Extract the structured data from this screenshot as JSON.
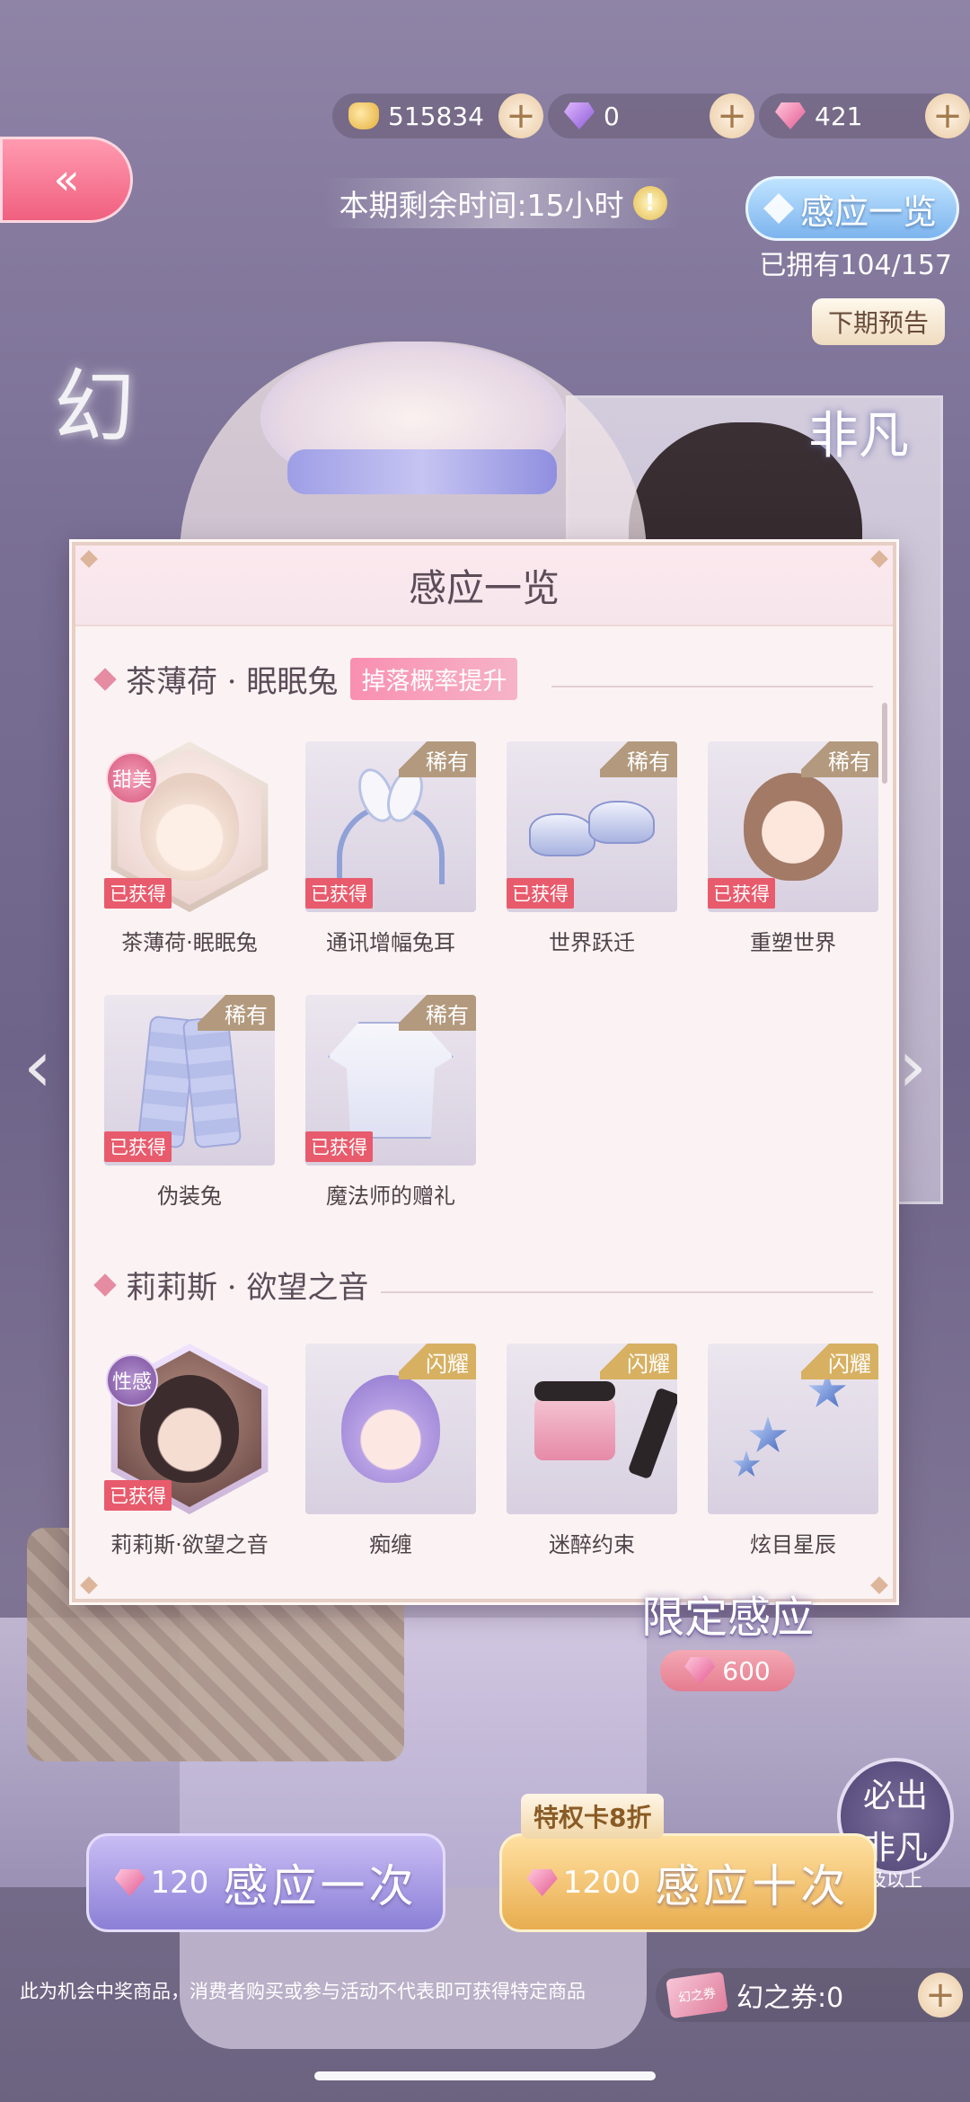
{
  "currencies": [
    {
      "icon": "gold-coin-icon",
      "value": "515834"
    },
    {
      "icon": "purple-diamond-icon",
      "value": "0"
    },
    {
      "icon": "pink-diamond-icon",
      "value": "421"
    }
  ],
  "back_icon": "«",
  "timer_text": "本期剩余时间:15小时",
  "warn_glyph": "!",
  "overview_button": "感应一览",
  "owned_text": "已拥有104/157",
  "preview_button": "下期预告",
  "bg_text": {
    "side_title": "幻",
    "badge": "非凡"
  },
  "modal": {
    "title": "感应一览",
    "sections": [
      {
        "name": "茶薄荷 · 眠眠兔",
        "tag": "掉落概率提升",
        "items": [
          {
            "label": "茶薄荷·眠眠兔",
            "rarity": "稀有",
            "badge": "甜美",
            "status": "已获得"
          },
          {
            "label": "通讯增幅兔耳",
            "rarity": "稀有",
            "status": "已获得"
          },
          {
            "label": "世界跃迁",
            "rarity": "稀有",
            "status": "已获得"
          },
          {
            "label": "重塑世界",
            "rarity": "稀有",
            "status": "已获得"
          },
          {
            "label": "伪装兔",
            "rarity": "稀有",
            "status": "已获得"
          },
          {
            "label": "魔法师的赠礼",
            "rarity": "稀有",
            "status": "已获得"
          }
        ]
      },
      {
        "name": "莉莉斯 · 欲望之音",
        "items": [
          {
            "label": "莉莉斯·欲望之音",
            "rarity": "闪耀",
            "badge": "性感",
            "status": "已获得"
          },
          {
            "label": "痴缠",
            "rarity": "闪耀"
          },
          {
            "label": "迷醉约束",
            "rarity": "闪耀"
          },
          {
            "label": "炫目星辰",
            "rarity": "闪耀"
          }
        ]
      }
    ]
  },
  "limited": {
    "title": "限定感应",
    "price": "600"
  },
  "guarantee": {
    "line1": "必出",
    "line2": "非凡",
    "line3": "及以上"
  },
  "privilege_discount": "特权卡8折",
  "pull_once": {
    "cost": "120",
    "label": "感应一次"
  },
  "pull_ten": {
    "cost": "1200",
    "label": "感应十次"
  },
  "disclaimer": "此为机会中奖商品，消费者购买或参与活动不代表即可获得特定商品",
  "ticket": {
    "icon_text": "幻之券",
    "label": "幻之券:0"
  },
  "plus_glyph": "+",
  "colors": {
    "accent_pink": "#e85b6c",
    "gold": "#e8ad4f",
    "lavender": "#8b7fd6",
    "sky_blue": "#7db4ee"
  }
}
